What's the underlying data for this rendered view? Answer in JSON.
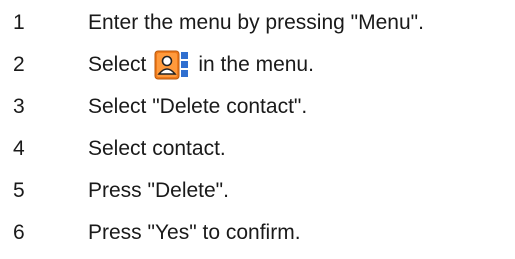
{
  "steps": [
    {
      "number": "1",
      "text": "Enter the menu by pressing \"Menu\"."
    },
    {
      "number": "2",
      "text_before": "Select",
      "icon": "contacts-icon",
      "text_after": "in the menu."
    },
    {
      "number": "3",
      "text": "Select \"Delete contact\"."
    },
    {
      "number": "4",
      "text": "Select contact."
    },
    {
      "number": "5",
      "text": "Press \"Delete\"."
    },
    {
      "number": "6",
      "text": "Press \"Yes\" to confirm."
    }
  ],
  "colors": {
    "text": "#1a1a1a",
    "icon_orange": "#f07a1a",
    "icon_blue": "#2f6fd0"
  }
}
